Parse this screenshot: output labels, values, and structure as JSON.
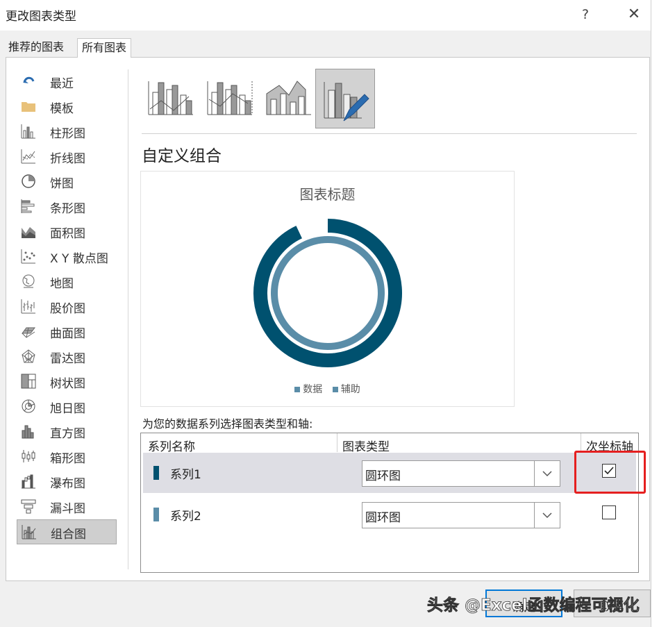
{
  "window": {
    "title": "更改图表类型",
    "help_label": "?",
    "close_label": "✕"
  },
  "tabs": [
    {
      "label": "推荐的图表",
      "selected": false
    },
    {
      "label": "所有图表",
      "selected": true
    }
  ],
  "sidebar": {
    "items": [
      {
        "label": "最近",
        "icon": "recent-icon"
      },
      {
        "label": "模板",
        "icon": "folder-icon"
      },
      {
        "label": "柱形图",
        "icon": "column-chart-icon"
      },
      {
        "label": "折线图",
        "icon": "line-chart-icon"
      },
      {
        "label": "饼图",
        "icon": "pie-chart-icon"
      },
      {
        "label": "条形图",
        "icon": "bar-chart-icon"
      },
      {
        "label": "面积图",
        "icon": "area-chart-icon"
      },
      {
        "label": "X Y 散点图",
        "icon": "scatter-chart-icon"
      },
      {
        "label": "地图",
        "icon": "map-chart-icon"
      },
      {
        "label": "股价图",
        "icon": "stock-chart-icon"
      },
      {
        "label": "曲面图",
        "icon": "surface-chart-icon"
      },
      {
        "label": "雷达图",
        "icon": "radar-chart-icon"
      },
      {
        "label": "树状图",
        "icon": "treemap-chart-icon"
      },
      {
        "label": "旭日图",
        "icon": "sunburst-chart-icon"
      },
      {
        "label": "直方图",
        "icon": "histogram-chart-icon"
      },
      {
        "label": "箱形图",
        "icon": "box-whisker-chart-icon"
      },
      {
        "label": "瀑布图",
        "icon": "waterfall-chart-icon"
      },
      {
        "label": "漏斗图",
        "icon": "funnel-chart-icon"
      },
      {
        "label": "组合图",
        "icon": "combo-chart-icon",
        "selected": true
      }
    ]
  },
  "subtypes": [
    {
      "icon": "clustered-column-line-icon",
      "selected": false
    },
    {
      "icon": "clustered-column-line-secondary-axis-icon",
      "selected": false
    },
    {
      "icon": "stacked-area-clustered-column-icon",
      "selected": false
    },
    {
      "icon": "custom-combination-icon",
      "selected": true
    }
  ],
  "main": {
    "section_title": "自定义组合",
    "series_prompt": "为您的数据系列选择图表类型和轴:"
  },
  "chart_data": {
    "type": "doughnut",
    "title": "图表标题",
    "series": [
      {
        "name": "数据",
        "value": 0.93,
        "color": "#00516f",
        "ring": "outer"
      },
      {
        "name": "辅助",
        "value": 1.0,
        "color": "#5a8da8",
        "ring": "inner"
      }
    ],
    "legend": [
      "数据",
      "辅助"
    ],
    "legend_position": "bottom"
  },
  "series_table": {
    "headers": {
      "name": "系列名称",
      "type": "图表类型",
      "secondary_axis": "次坐标轴"
    },
    "rows": [
      {
        "name": "系列1",
        "chart_type": "圆环图",
        "secondary_axis": true,
        "color": "#00516f",
        "selected": true
      },
      {
        "name": "系列2",
        "chart_type": "圆环图",
        "secondary_axis": false,
        "color": "#5a8da8",
        "selected": false
      }
    ]
  },
  "buttons": {
    "ok_label": "确定",
    "cancel_label": "取消"
  },
  "watermark": "头条 @Excel函数编程可视化",
  "colors": {
    "dark_series": "#00516f",
    "light_series": "#5a8da8",
    "highlight": "#e51f1f",
    "focus": "#0078d7"
  }
}
